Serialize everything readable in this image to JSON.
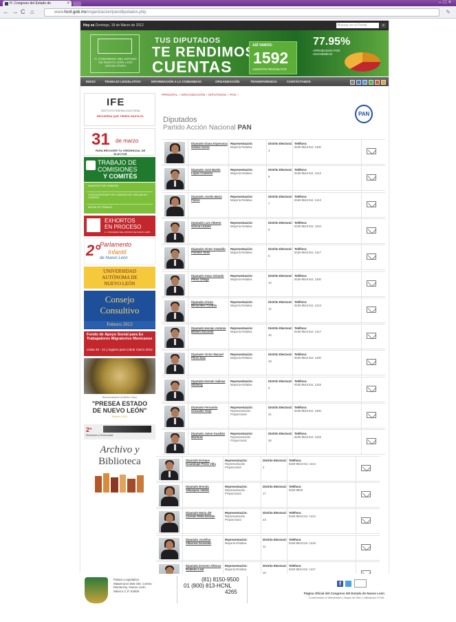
{
  "browser": {
    "tab_title": "H. Congreso del Estado de",
    "url_prefix": "www.",
    "url_domain": "hcnl.gob.mx",
    "url_path": "/organizacion/pan/diputados.php"
  },
  "topbar": {
    "date_prefix": "Hoy es",
    "date_text": "Domingo, 18 de Marzo de 2012",
    "search_placeholder": "Buscar en el Portal"
  },
  "banner": {
    "logo_text": "H. CONGRESO DEL ESTADO DE NUEVO LEÓN LXXII LEGISLATURA",
    "line1": "TUS DIPUTADOS",
    "line2": "TE RENDIMOS",
    "line3": "CUENTAS",
    "stat_label": "ASÍ VAMOS:",
    "stat_number": "1592",
    "stat_caption": "ASUNTOS RESUELTOS",
    "percent": "77.95%",
    "percent_caption": "APROBADOS POR UNANIMIDAD"
  },
  "menu": [
    "INICIO",
    "TRABAJO LEGISLATIVO",
    "INFORMACIÓN A LA COMUNIDAD",
    "ORGANIZACIÓN",
    "TRANSPARENCIA",
    "CONTÁCTANOS"
  ],
  "sidebar": {
    "ife_title": "IFE",
    "ife_sub": "INSTITUTO FEDERAL ELECTORAL",
    "ife_reminder": "RECUERDA QUE TIENES HASTA EL",
    "ife_day": "31",
    "ife_month": "de marzo",
    "ife_caption": "PARA RECOGER TU CREDENCIAL DE ELECTOR",
    "trabajo_1": "TRABAJO DE",
    "trabajo_2": "COMISIONES",
    "trabajo_3": "Y COMITÉS",
    "gl_1": "ASUNTOS POR COMISIÓN",
    "gl_2": "CONVOCATORIAS POR COMISIÓN DE VIGILANCIA Y COMITÉS",
    "gl_3": "MESAS DE TRABAJO",
    "exh_1": "EXHORTOS",
    "exh_2": "EN PROCESO",
    "exh_3": "H. CONGRESO DEL ESTADO DE NUEVO LEÓN",
    "par_n": "2°",
    "par_1": "Parlamento",
    "par_2": "Infantil",
    "par_3": "de Nuevo León",
    "uanl_1": "UNIVERSIDAD",
    "uanl_2": "AUTÓNOMA DE",
    "uanl_3": "NUEVO LEÓN",
    "con_1": "Consejo",
    "con_2": "Consultivo",
    "con_3": "Febrero 2012",
    "fondo_1": "Fondo de Apoyo Social para Ex Trabajadores Migratorios Mexicanos",
    "fondo_2": "Listas 40 - 41 y lugares para cobrar marzo 2012",
    "presea_1": "Reconocimiento al Mérito Cívico",
    "presea_2": "\"PRESEA ESTADO",
    "presea_3": "DE NUEVO LEÓN\"",
    "presea_4": "Edición 2011",
    "elec_1": "2°",
    "elec_2": "Elecciones y Democracia",
    "arch_1": "Archivo y",
    "arch_2": "Biblioteca"
  },
  "content": {
    "breadcrumb": [
      "PRINCIPAL",
      "ORGANIZACIÓN",
      "DIPUTADOS",
      "PAN"
    ],
    "title": "Diputados",
    "subtitle_prefix": "Partido Acción Nacional",
    "subtitle_bold": "PAN",
    "party_logo": "PAN",
    "col_rep": "Representación:",
    "col_dist": "Distrito Electoral:",
    "col_tel": "Teléfono:",
    "rows": [
      {
        "name": "Diputado Diana Esperanza Gámez Garza",
        "rep": "Mayoría Relativa",
        "dist": "4",
        "tel": "8150-9544 Ext. 1400",
        "gender": "f"
      },
      {
        "name": "Diputado José Martín López Cisneros",
        "rep": "Mayoría Relativa",
        "dist": "9",
        "tel": "8150-9544 Ext. 1413",
        "gender": "m"
      },
      {
        "name": "Diputado Josefa María Flores",
        "rep": "Mayoría Relativa",
        "dist": "7",
        "tel": "8150-9544 Ext. 1413",
        "gender": "f"
      },
      {
        "name": "Diputado Luis Alberto García Lozano",
        "rep": "Mayoría Relativa",
        "dist": "8",
        "tel": "8150-9543 Ext. 1310",
        "gender": "m"
      },
      {
        "name": "Diputado Víctor Oswaldo Fuentes Solís",
        "rep": "Mayoría Relativa",
        "dist": "5",
        "tel": "8150-9543 Ext. 1317",
        "gender": "m"
      },
      {
        "name": "Diputado Omar Orlando Pérez Ortega",
        "rep": "Mayoría Relativa",
        "dist": "10",
        "tel": "8150-9544 Ext. 1300",
        "gender": "m"
      },
      {
        "name": "Diputado Arturo Benavides Castillo",
        "rep": "Mayoría Relativa",
        "dist": "12",
        "tel": "8150-9544 Ext. 1413",
        "gender": "m"
      },
      {
        "name": "Diputado Hernán Antonio Belden Elizondo",
        "rep": "Mayoría Relativa",
        "dist": "16",
        "tel": "8150-9544 Ext. 1417",
        "gender": "m"
      },
      {
        "name": "Diputado Víctor Manuel Pérez Díaz",
        "rep": "Mayoría Relativa",
        "dist": "19",
        "tel": "8150-9544 Ext. 1400",
        "gender": "m"
      },
      {
        "name": "Diputado Hernán Salinas Wolberg",
        "rep": "Mayoría Relativa",
        "dist": "6",
        "tel": "8150-9543 Ext. 1316",
        "gender": "m"
      },
      {
        "name": "Diputado Fernando González Viejo",
        "rep": "Representación Proporcional",
        "dist": "21",
        "tel": "8150-9543 Ext. 1300",
        "gender": "m"
      },
      {
        "name": "Diputado Jaime Guadián Martínez",
        "rep": "Representación Proporcional",
        "dist": "26",
        "tel": "8150-9543 Ext. 1316",
        "gender": "m"
      },
      {
        "name": "Diputado Enrique Guadalupe Pérez Villa",
        "rep": "Representación Proporcional",
        "dist": "2",
        "tel": "8150-9544 Ext. 1414",
        "gender": "m"
      },
      {
        "name": "Diputado Brenda Velázquez Valdez",
        "rep": "Representación Proporcional",
        "dist": "17",
        "tel": "8150-9500",
        "gender": "f"
      },
      {
        "name": "Diputado María del Carmen Peña Dorado",
        "rep": "Representación Proporcional",
        "dist": "23",
        "tel": "8150-9544 Ext. 1414",
        "gender": "f"
      },
      {
        "name": "Diputado Josefina Villarreal González",
        "rep": "Mayoría Relativa",
        "dist": "11",
        "tel": "8150-9543 Ext. 1318",
        "gender": "f"
      },
      {
        "name": "Diputado Ernesto Alfonso Robledo Leal",
        "rep": "Mayoría Relativa",
        "dist": "15",
        "tel": "8150-9544 Ext. 1417",
        "gender": "m"
      }
    ]
  },
  "footer": {
    "address_1": "Palacio Legislativo",
    "address_2": "Matamoros 555 Ote. Centro",
    "address_3": "Monterrey, Nuevo León",
    "address_4": "México C.P. 64000",
    "tel_1": "(81) 8150-9500",
    "tel_2": "01 (800) 813-HCNL",
    "tel_3": "4265",
    "rss_label": "",
    "right_1": "Página Oficial del Congreso del Estado de Nuevo León",
    "right_2": "Comentarios al Webmaster | Mapa del Sitio | Validación HTML"
  }
}
